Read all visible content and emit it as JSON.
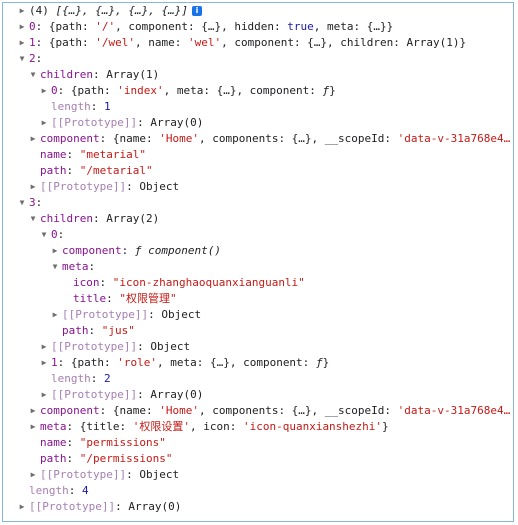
{
  "console": {
    "lines": [
      {
        "tri": "▶",
        "segs": [
          [
            "p",
            "(4) "
          ],
          [
            "pi",
            "[{…}, {…}, {…}, {…}]"
          ]
        ],
        "info": "i"
      },
      {
        "tri": "▶",
        "segs": [
          [
            "k",
            "0"
          ],
          [
            "p",
            ": {path: "
          ],
          [
            "s",
            "'/'"
          ],
          [
            "p",
            ", component: {…}, hidden: "
          ],
          [
            "n",
            "true"
          ],
          [
            "p",
            ", meta: {…}}"
          ]
        ]
      },
      {
        "tri": "▶",
        "segs": [
          [
            "k",
            "1"
          ],
          [
            "p",
            ": {path: "
          ],
          [
            "s",
            "'/wel'"
          ],
          [
            "p",
            ", name: "
          ],
          [
            "s",
            "'wel'"
          ],
          [
            "p",
            ", component: {…}, children: Array(1)}"
          ]
        ]
      },
      {
        "tri": "▼",
        "segs": [
          [
            "k",
            "2"
          ],
          [
            "p",
            ":"
          ]
        ]
      },
      {
        "tri": "▼",
        "segs": [
          [
            "k",
            "children"
          ],
          [
            "p",
            ": Array(1)"
          ]
        ]
      },
      {
        "tri": "▶",
        "segs": [
          [
            "k",
            "0"
          ],
          [
            "p",
            ": {path: "
          ],
          [
            "s",
            "'index'"
          ],
          [
            "p",
            ", meta: {…}, component: "
          ],
          [
            "pi",
            "ƒ"
          ],
          [
            "p",
            "}"
          ]
        ]
      },
      {
        "tri": "",
        "segs": [
          [
            "kd",
            "length"
          ],
          [
            "p",
            ": "
          ],
          [
            "n",
            "1"
          ]
        ]
      },
      {
        "tri": "▶",
        "segs": [
          [
            "kd",
            "[[Prototype]]"
          ],
          [
            "p",
            ": Array(0)"
          ]
        ]
      },
      {
        "tri": "▶",
        "segs": [
          [
            "k",
            "component"
          ],
          [
            "p",
            ": {name: "
          ],
          [
            "s",
            "'Home'"
          ],
          [
            "p",
            ", components: {…}, __scopeId: "
          ],
          [
            "s",
            "'data-v-31a768e4…"
          ]
        ]
      },
      {
        "tri": "",
        "segs": [
          [
            "k",
            "name"
          ],
          [
            "p",
            ": "
          ],
          [
            "s",
            "\"metarial\""
          ]
        ]
      },
      {
        "tri": "",
        "segs": [
          [
            "k",
            "path"
          ],
          [
            "p",
            ": "
          ],
          [
            "s",
            "\"/metarial\""
          ]
        ]
      },
      {
        "tri": "▶",
        "segs": [
          [
            "kd",
            "[[Prototype]]"
          ],
          [
            "p",
            ": Object"
          ]
        ]
      },
      {
        "tri": "▼",
        "segs": [
          [
            "k",
            "3"
          ],
          [
            "p",
            ":"
          ]
        ]
      },
      {
        "tri": "▼",
        "segs": [
          [
            "k",
            "children"
          ],
          [
            "p",
            ": Array(2)"
          ]
        ]
      },
      {
        "tri": "▼",
        "segs": [
          [
            "k",
            "0"
          ],
          [
            "p",
            ":"
          ]
        ]
      },
      {
        "tri": "▶",
        "segs": [
          [
            "k",
            "component"
          ],
          [
            "p",
            ": "
          ],
          [
            "pi",
            "ƒ component()"
          ]
        ]
      },
      {
        "tri": "▼",
        "segs": [
          [
            "k",
            "meta"
          ],
          [
            "p",
            ":"
          ]
        ]
      },
      {
        "tri": "",
        "segs": [
          [
            "k",
            "icon"
          ],
          [
            "p",
            ": "
          ],
          [
            "s",
            "\"icon-zhanghaoquanxianguanli\""
          ]
        ]
      },
      {
        "tri": "",
        "segs": [
          [
            "k",
            "title"
          ],
          [
            "p",
            ": "
          ],
          [
            "s",
            "\"权限管理\""
          ]
        ]
      },
      {
        "tri": "▶",
        "segs": [
          [
            "kd",
            "[[Prototype]]"
          ],
          [
            "p",
            ": Object"
          ]
        ]
      },
      {
        "tri": "",
        "segs": [
          [
            "k",
            "path"
          ],
          [
            "p",
            ": "
          ],
          [
            "s",
            "\"jus\""
          ]
        ]
      },
      {
        "tri": "▶",
        "segs": [
          [
            "kd",
            "[[Prototype]]"
          ],
          [
            "p",
            ": Object"
          ]
        ]
      },
      {
        "tri": "▶",
        "segs": [
          [
            "k",
            "1"
          ],
          [
            "p",
            ": {path: "
          ],
          [
            "s",
            "'role'"
          ],
          [
            "p",
            ", meta: {…}, component: "
          ],
          [
            "pi",
            "ƒ"
          ],
          [
            "p",
            "}"
          ]
        ]
      },
      {
        "tri": "",
        "segs": [
          [
            "kd",
            "length"
          ],
          [
            "p",
            ": "
          ],
          [
            "n",
            "2"
          ]
        ]
      },
      {
        "tri": "▶",
        "segs": [
          [
            "kd",
            "[[Prototype]]"
          ],
          [
            "p",
            ": Array(0)"
          ]
        ]
      },
      {
        "tri": "▶",
        "segs": [
          [
            "k",
            "component"
          ],
          [
            "p",
            ": {name: "
          ],
          [
            "s",
            "'Home'"
          ],
          [
            "p",
            ", components: {…}, __scopeId: "
          ],
          [
            "s",
            "'data-v-31a768e4…"
          ]
        ]
      },
      {
        "tri": "▶",
        "segs": [
          [
            "k",
            "meta"
          ],
          [
            "p",
            ": {title: "
          ],
          [
            "s",
            "'权限设置'"
          ],
          [
            "p",
            ", icon: "
          ],
          [
            "s",
            "'icon-quanxianshezhi'"
          ],
          [
            "p",
            "}"
          ]
        ]
      },
      {
        "tri": "",
        "segs": [
          [
            "k",
            "name"
          ],
          [
            "p",
            ": "
          ],
          [
            "s",
            "\"permissions\""
          ]
        ]
      },
      {
        "tri": "",
        "segs": [
          [
            "k",
            "path"
          ],
          [
            "p",
            ": "
          ],
          [
            "s",
            "\"/permissions\""
          ]
        ]
      },
      {
        "tri": "▶",
        "segs": [
          [
            "kd",
            "[[Prototype]]"
          ],
          [
            "p",
            ": Object"
          ]
        ]
      },
      {
        "tri": "",
        "segs": [
          [
            "kd",
            "length"
          ],
          [
            "p",
            ": "
          ],
          [
            "n",
            "4"
          ]
        ]
      },
      {
        "tri": "▶",
        "segs": [
          [
            "kd",
            "[[Prototype]]"
          ],
          [
            "p",
            ": Array(0)"
          ]
        ]
      }
    ]
  }
}
